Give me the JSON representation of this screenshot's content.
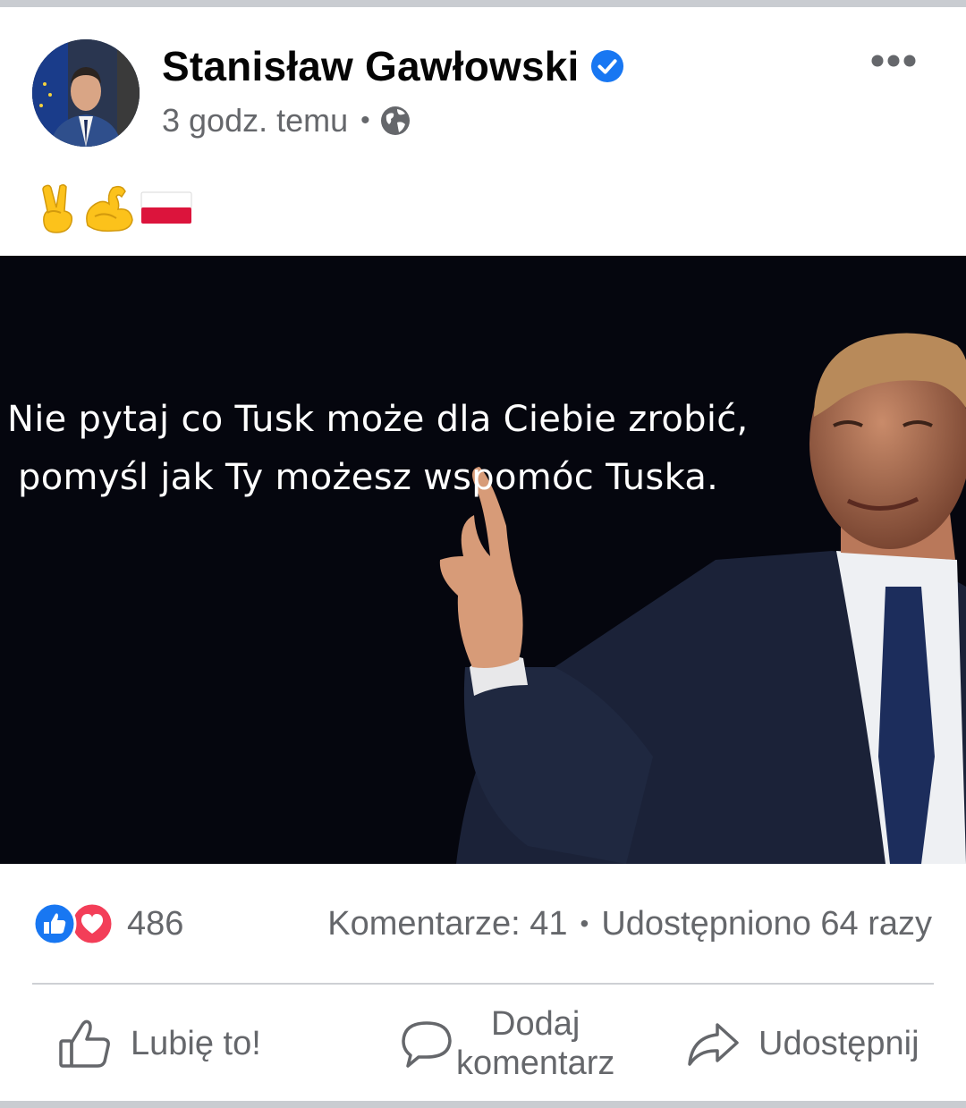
{
  "post": {
    "author": "Stanisław Gawłowski",
    "timestamp": "3 godz. temu",
    "separator": "•",
    "caption_emoji": [
      "victory-hand",
      "flexed-biceps",
      "flag-poland"
    ],
    "image_text": {
      "line1": "Nie pytaj co Tusk może dla Ciebie zrobić,",
      "line2": "pomyśl jak Ty możesz wspomóc Tuska."
    },
    "icons": {
      "verified": "verified-badge-icon",
      "privacy": "globe-icon",
      "more": "more-options-icon"
    }
  },
  "reactions": {
    "count": "486",
    "comments": "Komentarze: 41",
    "separator": "•",
    "shares": "Udostępniono 64 razy"
  },
  "actions": {
    "like": "Lubię to!",
    "comment_line1": "Dodaj",
    "comment_line2": "komentarz",
    "share": "Udostępnij"
  },
  "colors": {
    "brand_blue": "#1877f2",
    "love_red": "#f33e58",
    "secondary_text": "#65676b",
    "divider": "#ced0d4"
  }
}
